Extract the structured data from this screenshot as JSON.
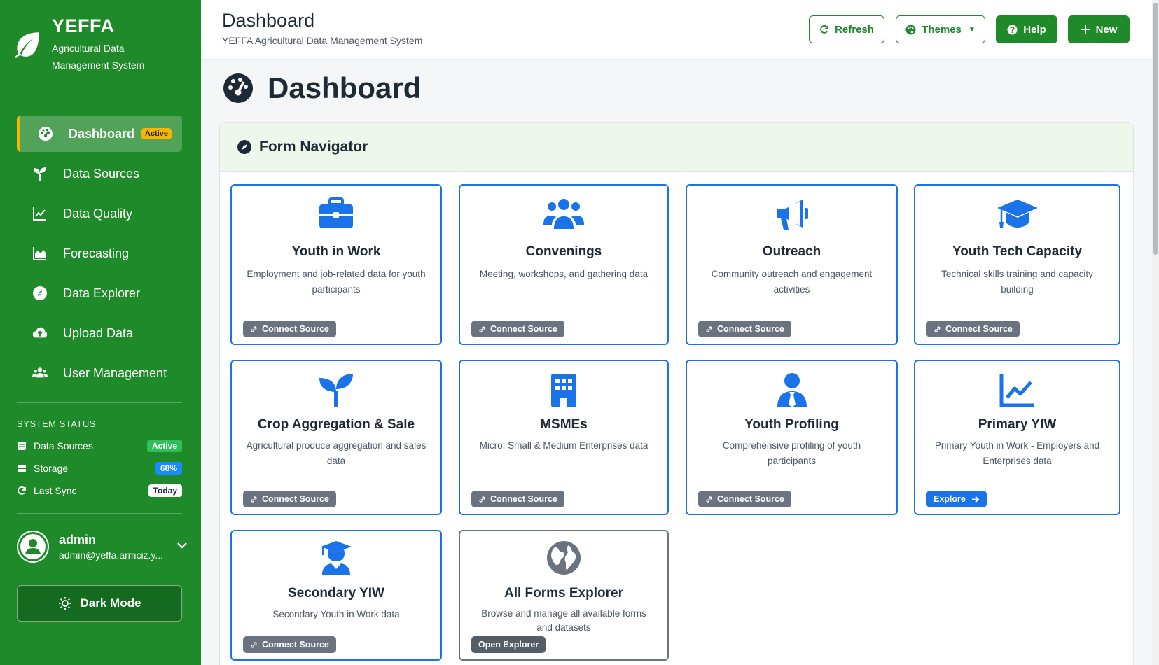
{
  "brand": {
    "name": "YEFFA",
    "subtitle": "Agricultural Data Management System"
  },
  "nav": [
    {
      "label": "Dashboard",
      "icon": "gauge-icon",
      "active": true,
      "badge": "Active"
    },
    {
      "label": "Data Sources",
      "icon": "seedling-icon"
    },
    {
      "label": "Data Quality",
      "icon": "line-chart-icon"
    },
    {
      "label": "Forecasting",
      "icon": "area-chart-icon"
    },
    {
      "label": "Data Explorer",
      "icon": "compass-icon"
    },
    {
      "label": "Upload Data",
      "icon": "cloud-upload-icon"
    },
    {
      "label": "User Management",
      "icon": "users-icon"
    }
  ],
  "system_status": {
    "title": "SYSTEM STATUS",
    "rows": [
      {
        "label": "Data Sources",
        "value": "Active"
      },
      {
        "label": "Storage",
        "value": "68%"
      },
      {
        "label": "Last Sync",
        "value": "Today"
      }
    ]
  },
  "user": {
    "name": "admin",
    "email": "admin@yeffa.armciz.y..."
  },
  "dark_mode_label": "Dark Mode",
  "header": {
    "title": "Dashboard",
    "subtitle": "YEFFA Agricultural Data Management System",
    "buttons": {
      "refresh": "Refresh",
      "themes": "Themes",
      "help": "Help",
      "new": "New"
    }
  },
  "page_title": "Dashboard",
  "form_navigator": {
    "title": "Form Navigator",
    "cards": [
      {
        "title": "Youth in Work",
        "desc": "Employment and job-related data for youth participants",
        "button": "Connect Source",
        "icon": "briefcase-icon"
      },
      {
        "title": "Convenings",
        "desc": "Meeting, workshops, and gathering data",
        "button": "Connect Source",
        "icon": "users-icon"
      },
      {
        "title": "Outreach",
        "desc": "Community outreach and engagement activities",
        "button": "Connect Source",
        "icon": "megaphone-icon"
      },
      {
        "title": "Youth Tech Capacity",
        "desc": "Technical skills training and capacity building",
        "button": "Connect Source",
        "icon": "graduation-cap-icon"
      },
      {
        "title": "Crop Aggregation & Sale",
        "desc": "Agricultural produce aggregation and sales data",
        "button": "Connect Source",
        "icon": "seedling-icon"
      },
      {
        "title": "MSMEs",
        "desc": "Micro, Small & Medium Enterprises data",
        "button": "Connect Source",
        "icon": "building-icon"
      },
      {
        "title": "Youth Profiling",
        "desc": "Comprehensive profiling of youth participants",
        "button": "Connect Source",
        "icon": "user-tie-icon"
      },
      {
        "title": "Primary YIW",
        "desc": "Primary Youth in Work - Employers and Enterprises data",
        "button": "Explore",
        "icon": "line-chart-icon"
      },
      {
        "title": "Secondary YIW",
        "desc": "Secondary Youth in Work data",
        "button": "Connect Source",
        "icon": "graduate-icon"
      },
      {
        "title": "All Forms Explorer",
        "desc": "Browse and manage all available forms and datasets",
        "button": "Open Explorer",
        "icon": "globe-icon"
      }
    ]
  },
  "colors": {
    "sidebar": "#1f8a2a",
    "accent_blue": "#1a73e8",
    "active_badge": "#f7b500",
    "grey_button": "#6b7280"
  }
}
